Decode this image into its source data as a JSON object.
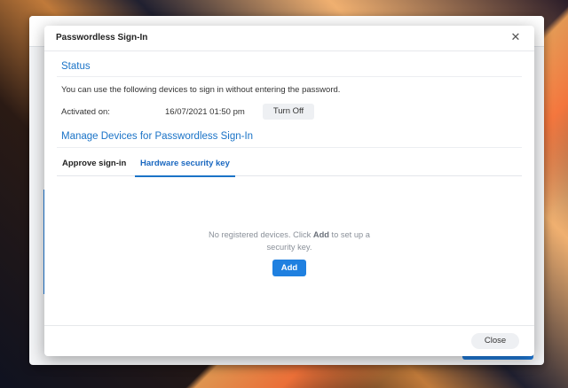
{
  "dialog": {
    "title": "Passwordless Sign-In",
    "close_glyph": "✕"
  },
  "status": {
    "heading": "Status",
    "description": "You can use the following devices to sign in without entering the password.",
    "activated_label": "Activated on:",
    "activated_value": "16/07/2021 01:50 pm",
    "turn_off_label": "Turn Off"
  },
  "manage": {
    "heading": "Manage Devices for Passwordless Sign-In",
    "tabs": [
      {
        "label": "Approve sign-in",
        "active": false
      },
      {
        "label": "Hardware security key",
        "active": true
      }
    ],
    "empty_prefix": "No registered devices. Click ",
    "empty_bold": "Add",
    "empty_suffix": " to set up a security key.",
    "add_label": "Add"
  },
  "footer": {
    "close_label": "Close"
  },
  "colors": {
    "accent": "#1a73c7",
    "primary_button": "#1f80e0"
  }
}
